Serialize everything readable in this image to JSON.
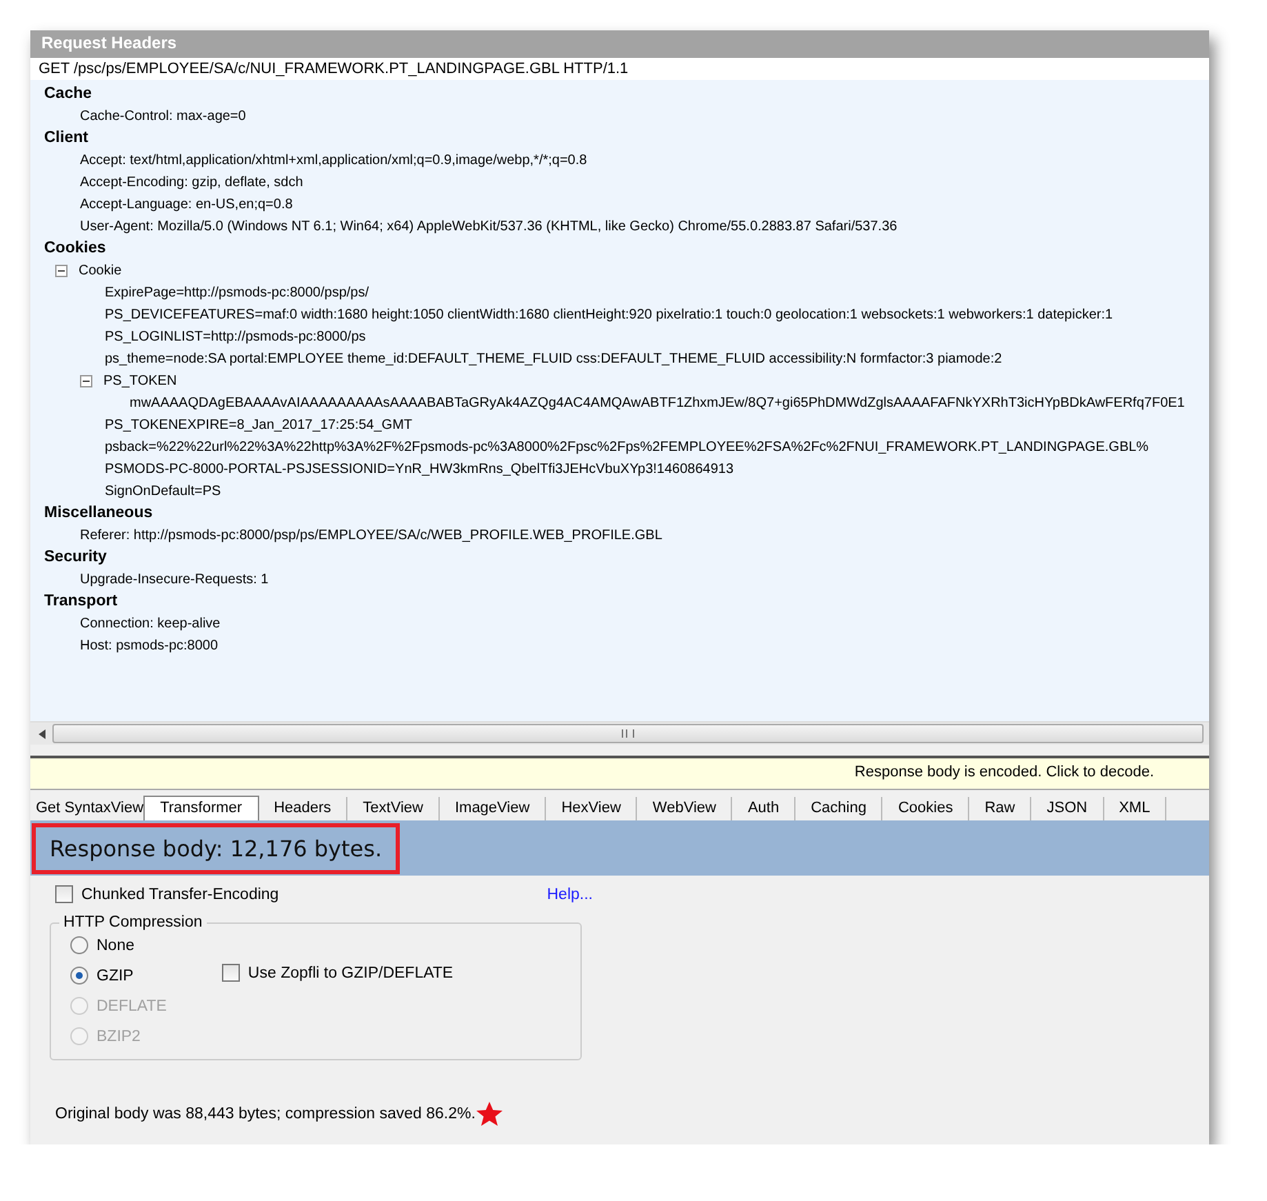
{
  "request_headers": {
    "title": "Request Headers",
    "request_line": "GET /psc/ps/EMPLOYEE/SA/c/NUI_FRAMEWORK.PT_LANDINGPAGE.GBL HTTP/1.1",
    "groups": [
      {
        "name": "Cache",
        "items": [
          {
            "text": "Cache-Control: max-age=0"
          }
        ]
      },
      {
        "name": "Client",
        "items": [
          {
            "text": "Accept: text/html,application/xhtml+xml,application/xml;q=0.9,image/webp,*/*;q=0.8"
          },
          {
            "text": "Accept-Encoding: gzip, deflate, sdch"
          },
          {
            "text": "Accept-Language: en-US,en;q=0.8"
          },
          {
            "text": "User-Agent: Mozilla/5.0 (Windows NT 6.1; Win64; x64) AppleWebKit/537.36 (KHTML, like Gecko) Chrome/55.0.2883.87 Safari/537.36"
          }
        ]
      },
      {
        "name": "Cookies",
        "items": [
          {
            "text": "Cookie",
            "expanded": true,
            "children": [
              {
                "text": "ExpirePage=http://psmods-pc:8000/psp/ps/"
              },
              {
                "text": "PS_DEVICEFEATURES=maf:0 width:1680 height:1050 clientWidth:1680 clientHeight:920 pixelratio:1 touch:0 geolocation:1 websockets:1 webworkers:1 datepicker:1"
              },
              {
                "text": "PS_LOGINLIST=http://psmods-pc:8000/ps"
              },
              {
                "text": "ps_theme=node:SA portal:EMPLOYEE theme_id:DEFAULT_THEME_FLUID css:DEFAULT_THEME_FLUID accessibility:N formfactor:3 piamode:2"
              },
              {
                "text": "PS_TOKEN",
                "expanded": true,
                "children": [
                  {
                    "text": "mwAAAAQDAgEBAAAAvAIAAAAAAAAAsAAAABABTaGRyAk4AZQg4AC4AMQAwABTF1ZhxmJEw/8Q7+gi65PhDMWdZglsAAAAFAFNkYXRhT3icHYpBDkAwFERfq7F0E1"
                  }
                ]
              },
              {
                "text": "PS_TOKENEXPIRE=8_Jan_2017_17:25:54_GMT"
              },
              {
                "text": "psback=%22%22url%22%3A%22http%3A%2F%2Fpsmods-pc%3A8000%2Fpsc%2Fps%2FEMPLOYEE%2FSA%2Fc%2FNUI_FRAMEWORK.PT_LANDINGPAGE.GBL%"
              },
              {
                "text": "PSMODS-PC-8000-PORTAL-PSJSESSIONID=YnR_HW3kmRns_QbelTfi3JEHcVbuXYp3!1460864913"
              },
              {
                "text": "SignOnDefault=PS"
              }
            ]
          }
        ]
      },
      {
        "name": "Miscellaneous",
        "items": [
          {
            "text": "Referer: http://psmods-pc:8000/psp/ps/EMPLOYEE/SA/c/WEB_PROFILE.WEB_PROFILE.GBL"
          }
        ]
      },
      {
        "name": "Security",
        "items": [
          {
            "text": "Upgrade-Insecure-Requests: 1"
          }
        ]
      },
      {
        "name": "Transport",
        "items": [
          {
            "text": "Connection: keep-alive"
          },
          {
            "text": "Host: psmods-pc:8000"
          }
        ]
      }
    ]
  },
  "notice": "Response body is encoded. Click to decode.",
  "tabs": [
    {
      "label": "Get SyntaxView",
      "selected": false
    },
    {
      "label": "Transformer",
      "selected": true
    },
    {
      "label": "Headers",
      "selected": false
    },
    {
      "label": "TextView",
      "selected": false
    },
    {
      "label": "ImageView",
      "selected": false
    },
    {
      "label": "HexView",
      "selected": false
    },
    {
      "label": "WebView",
      "selected": false
    },
    {
      "label": "Auth",
      "selected": false
    },
    {
      "label": "Caching",
      "selected": false
    },
    {
      "label": "Cookies",
      "selected": false
    },
    {
      "label": "Raw",
      "selected": false
    },
    {
      "label": "JSON",
      "selected": false
    },
    {
      "label": "XML",
      "selected": false
    }
  ],
  "response_body": "Response body: 12,176 bytes.",
  "chunked": {
    "label": "Chunked Transfer-Encoding",
    "checked": false
  },
  "help_link": "Help...",
  "compression": {
    "title": "HTTP Compression",
    "options": [
      {
        "label": "None",
        "selected": false,
        "disabled": false
      },
      {
        "label": "GZIP",
        "selected": true,
        "disabled": false
      },
      {
        "label": "DEFLATE",
        "selected": false,
        "disabled": true
      },
      {
        "label": "BZIP2",
        "selected": false,
        "disabled": true
      }
    ],
    "zopfli": {
      "label": "Use Zopfli to GZIP/DEFLATE",
      "checked": false
    }
  },
  "summary": "Original body was 88,443 bytes; compression saved 86.2%."
}
